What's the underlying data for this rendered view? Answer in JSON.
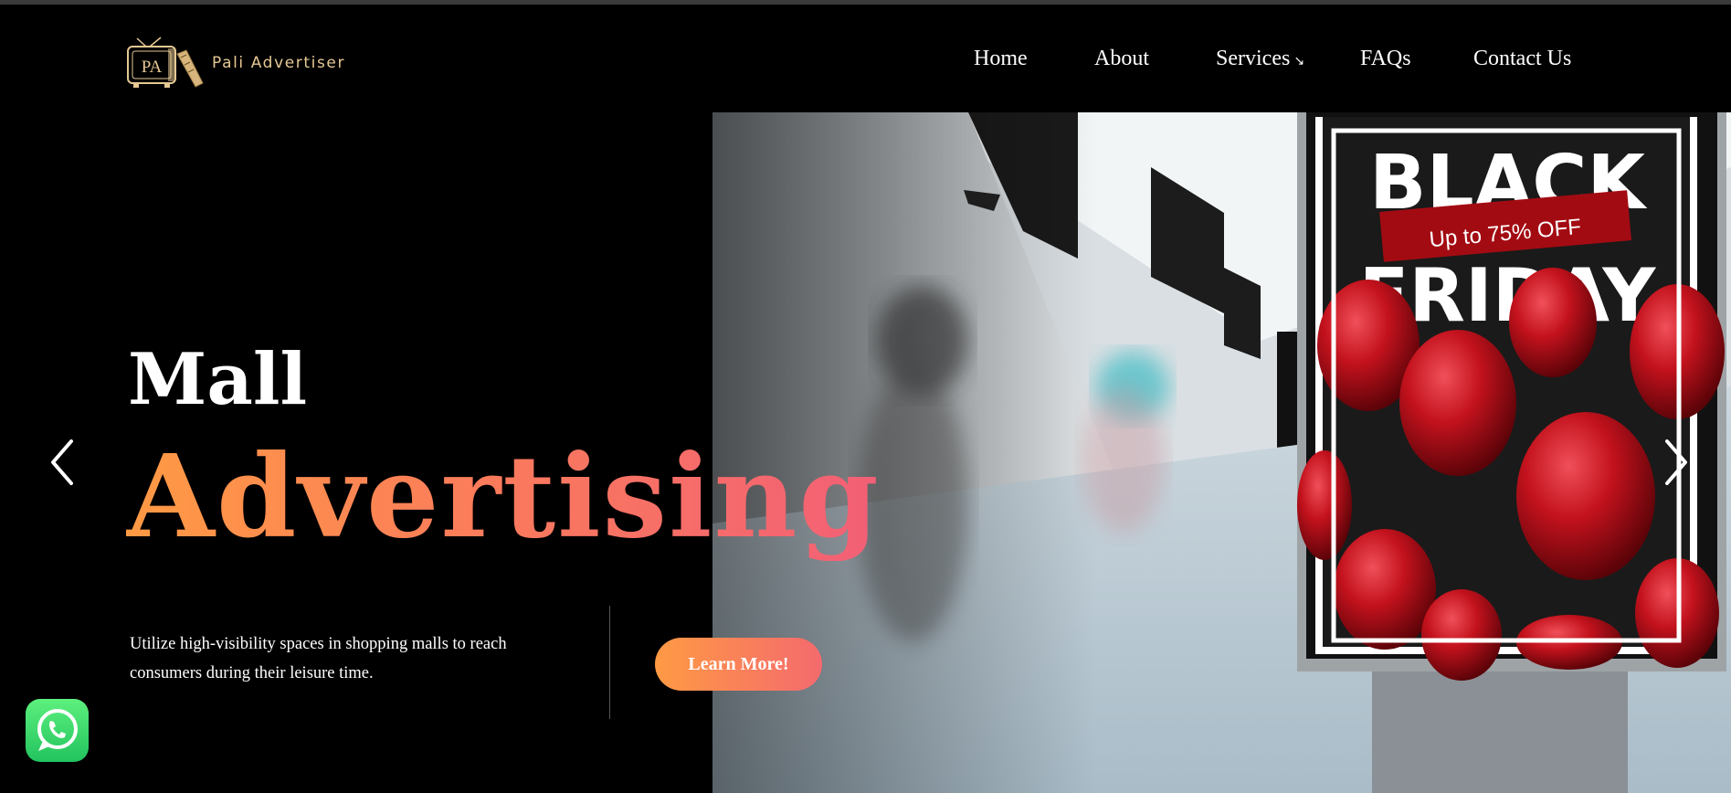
{
  "brand": {
    "logo_letters": "PA",
    "name": "Pali Advertiser"
  },
  "nav": {
    "items": [
      {
        "label": "Home"
      },
      {
        "label": "About"
      },
      {
        "label": "Services",
        "arrow": "↘"
      },
      {
        "label": "FAQs"
      },
      {
        "label": "Contact Us"
      }
    ]
  },
  "hero": {
    "title_line1": "Mall",
    "title_line2": "Advertising",
    "description": "Utilize high-visibility spaces in shopping malls to reach consumers during their leisure time.",
    "cta_label": "Learn More!"
  },
  "billboard": {
    "line1": "BLACK",
    "ribbon": "Up to 75% OFF",
    "line2": "FRIDAY"
  },
  "icons": {
    "prev": "chevron-left-icon",
    "next": "chevron-right-icon",
    "whatsapp": "whatsapp-icon",
    "logo": "tv-logo-icon"
  },
  "colors": {
    "accent_start": "#ff9a44",
    "accent_end": "#f25f76",
    "logo_gold": "#e5c893",
    "whatsapp_green": "#25d366",
    "ribbon_red": "#a30b12",
    "balloon_red": "#c3121d"
  }
}
